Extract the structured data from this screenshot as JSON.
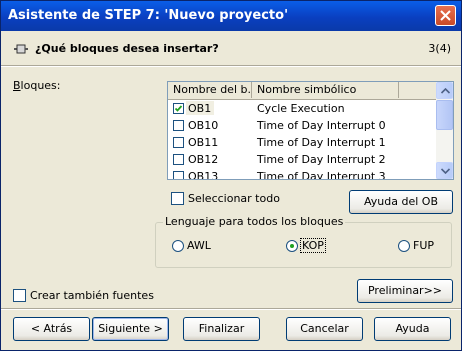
{
  "window": {
    "title": "Asistente de STEP 7: 'Nuevo proyecto'"
  },
  "header": {
    "question": "¿Qué bloques desea insertar?",
    "step": "3(4)"
  },
  "blocks": {
    "label": "Bloques:",
    "columns": [
      "Nombre del b...",
      "Nombre simbólico"
    ],
    "rows": [
      {
        "name": "OB1",
        "symbol": "Cycle Execution",
        "checked": true
      },
      {
        "name": "OB10",
        "symbol": "Time of Day Interrupt 0",
        "checked": false
      },
      {
        "name": "OB11",
        "symbol": "Time of Day Interrupt 1",
        "checked": false
      },
      {
        "name": "OB12",
        "symbol": "Time of Day Interrupt 2",
        "checked": false
      },
      {
        "name": "OB13",
        "symbol": "Time of Day Interrupt 3",
        "checked": false
      }
    ]
  },
  "select_all": {
    "label": "Seleccionar todo",
    "checked": false
  },
  "help_ob_button": "Ayuda del OB",
  "language": {
    "group_title": "Lenguaje para todos los bloques",
    "options": [
      "AWL",
      "KOP",
      "FUP"
    ],
    "selected": "KOP"
  },
  "create_sources": {
    "label": "Crear también fuentes",
    "checked": false
  },
  "preview_button": "Preliminar>>",
  "footer": {
    "back": "< Atrás",
    "next": "Siguiente >",
    "finish": "Finalizar",
    "cancel": "Cancelar",
    "help": "Ayuda"
  },
  "colors": {
    "titlebar": "#0a50d8",
    "dialog_bg": "#ece9d8",
    "radio_selected": "#21a121",
    "close_button": "#d45a36"
  },
  "icons": [
    "close-icon",
    "block-icon",
    "checkmark-icon",
    "scroll-up-icon",
    "scroll-down-icon"
  ]
}
